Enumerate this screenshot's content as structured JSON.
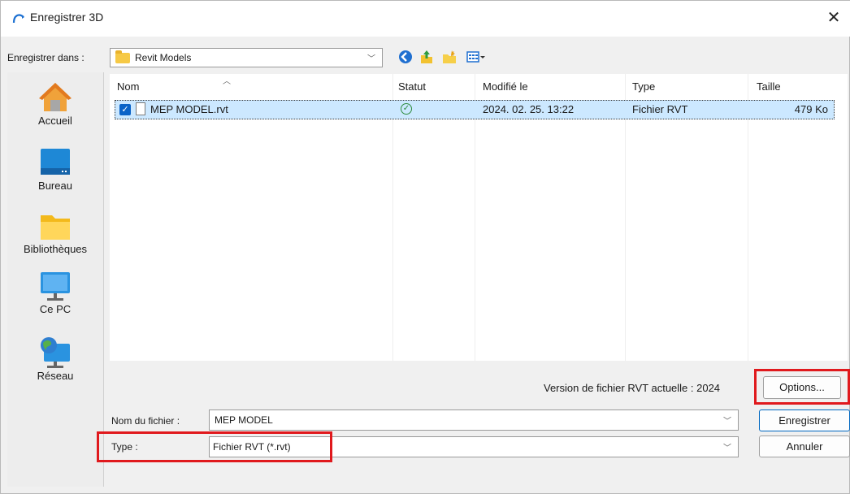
{
  "window": {
    "title": "Enregistrer 3D",
    "close": "✕"
  },
  "save_in": {
    "label": "Enregistrer dans :",
    "value": "Revit Models"
  },
  "places": [
    {
      "label": "Accueil",
      "icon": "home-icon"
    },
    {
      "label": "Bureau",
      "icon": "desktop-icon"
    },
    {
      "label": "Bibliothèques",
      "icon": "libraries-icon"
    },
    {
      "label": "Ce PC",
      "icon": "this-pc-icon"
    },
    {
      "label": "Réseau",
      "icon": "network-icon"
    }
  ],
  "table": {
    "headers": {
      "name": "Nom",
      "status": "Statut",
      "modified": "Modifié le",
      "type": "Type",
      "size": "Taille"
    },
    "rows": [
      {
        "name": "MEP MODEL.rvt",
        "status": "ok",
        "modified": "2024. 02. 25. 13:22",
        "type": "Fichier RVT",
        "size": "479 Ko"
      }
    ]
  },
  "version_text": "Version de fichier RVT actuelle : 2024",
  "buttons": {
    "options": "Options...",
    "save": "Enregistrer",
    "cancel": "Annuler"
  },
  "filename": {
    "label": "Nom du fichier :",
    "value": "MEP MODEL"
  },
  "filetype": {
    "label": "Type :",
    "value": "Fichier RVT (*.rvt)"
  },
  "colors": {
    "accent": "#0b63c7",
    "selection": "#cce8ff",
    "highlight": "#e0191d"
  }
}
